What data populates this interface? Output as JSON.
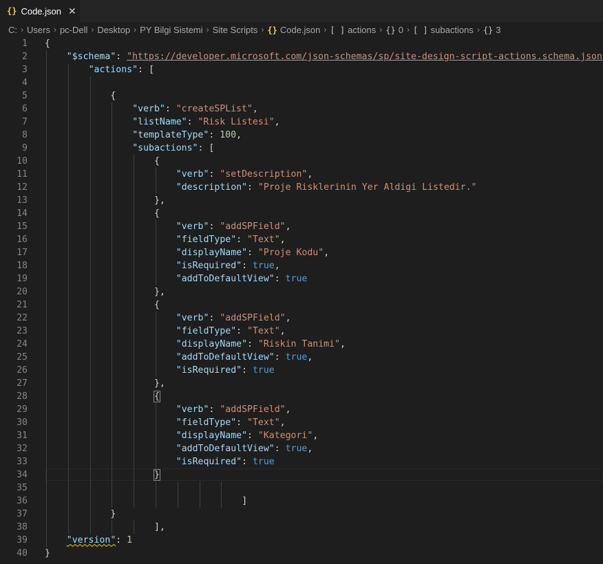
{
  "tab": {
    "icon": "{}",
    "title": "Code.json"
  },
  "breadcrumb": [
    {
      "symbol": "",
      "label": "C:"
    },
    {
      "symbol": "",
      "label": "Users"
    },
    {
      "symbol": "",
      "label": "pc-Dell"
    },
    {
      "symbol": "",
      "label": "Desktop"
    },
    {
      "symbol": "",
      "label": "PY Bilgi Sistemi"
    },
    {
      "symbol": "",
      "label": "Site Scripts"
    },
    {
      "symbol": "{}",
      "label": "Code.json"
    },
    {
      "symbol": "[ ]",
      "label": "actions"
    },
    {
      "symbol": "{}",
      "label": "0"
    },
    {
      "symbol": "[ ]",
      "label": "subactions"
    },
    {
      "symbol": "{}",
      "label": "3"
    }
  ],
  "editor": {
    "current_line": 34,
    "lines": [
      {
        "n": "1",
        "indent": 0,
        "tokens": [
          [
            "p",
            "{"
          ]
        ]
      },
      {
        "n": "2",
        "indent": 1,
        "tokens": [
          [
            "k",
            "\"$schema\""
          ],
          [
            "p",
            ": "
          ],
          [
            "u",
            "\"https://developer.microsoft.com/json-schemas/sp/site-design-script-actions.schema.json\""
          ],
          [
            "p",
            ","
          ]
        ]
      },
      {
        "n": "3",
        "indent": 2,
        "tokens": [
          [
            "k",
            "\"actions\""
          ],
          [
            "p",
            ": ["
          ]
        ]
      },
      {
        "n": "4",
        "indent": 0,
        "tokens": []
      },
      {
        "n": "5",
        "indent": 3,
        "tokens": [
          [
            "p",
            "{"
          ]
        ]
      },
      {
        "n": "6",
        "indent": 4,
        "tokens": [
          [
            "k",
            "\"verb\""
          ],
          [
            "p",
            ": "
          ],
          [
            "s",
            "\"createSPList\""
          ],
          [
            "p",
            ","
          ]
        ]
      },
      {
        "n": "7",
        "indent": 4,
        "tokens": [
          [
            "k",
            "\"listName\""
          ],
          [
            "p",
            ": "
          ],
          [
            "s",
            "\"Risk Listesi\""
          ],
          [
            "p",
            ","
          ]
        ]
      },
      {
        "n": "8",
        "indent": 4,
        "tokens": [
          [
            "k",
            "\"templateType\""
          ],
          [
            "p",
            ": "
          ],
          [
            "n",
            "100"
          ],
          [
            "p",
            ","
          ]
        ]
      },
      {
        "n": "9",
        "indent": 4,
        "tokens": [
          [
            "k",
            "\"subactions\""
          ],
          [
            "p",
            ": ["
          ]
        ]
      },
      {
        "n": "10",
        "indent": 5,
        "tokens": [
          [
            "p",
            "{"
          ]
        ]
      },
      {
        "n": "11",
        "indent": 6,
        "tokens": [
          [
            "k",
            "\"verb\""
          ],
          [
            "p",
            ": "
          ],
          [
            "s",
            "\"setDescription\""
          ],
          [
            "p",
            ","
          ]
        ]
      },
      {
        "n": "12",
        "indent": 6,
        "tokens": [
          [
            "k",
            "\"description\""
          ],
          [
            "p",
            ": "
          ],
          [
            "s",
            "\"Proje Risklerinin Yer Aldigi Listedir.\""
          ]
        ]
      },
      {
        "n": "13",
        "indent": 5,
        "tokens": [
          [
            "p",
            "},"
          ]
        ]
      },
      {
        "n": "14",
        "indent": 5,
        "tokens": [
          [
            "p",
            "{"
          ]
        ]
      },
      {
        "n": "15",
        "indent": 6,
        "tokens": [
          [
            "k",
            "\"verb\""
          ],
          [
            "p",
            ": "
          ],
          [
            "s",
            "\"addSPField\""
          ],
          [
            "p",
            ","
          ]
        ]
      },
      {
        "n": "16",
        "indent": 6,
        "tokens": [
          [
            "k",
            "\"fieldType\""
          ],
          [
            "p",
            ": "
          ],
          [
            "s",
            "\"Text\""
          ],
          [
            "p",
            ","
          ]
        ]
      },
      {
        "n": "17",
        "indent": 6,
        "tokens": [
          [
            "k",
            "\"displayName\""
          ],
          [
            "p",
            ": "
          ],
          [
            "s",
            "\"Proje Kodu\""
          ],
          [
            "p",
            ","
          ]
        ]
      },
      {
        "n": "18",
        "indent": 6,
        "tokens": [
          [
            "k",
            "\"isRequired\""
          ],
          [
            "p",
            ": "
          ],
          [
            "b",
            "true"
          ],
          [
            "p",
            ","
          ]
        ]
      },
      {
        "n": "19",
        "indent": 6,
        "tokens": [
          [
            "k",
            "\"addToDefaultView\""
          ],
          [
            "p",
            ": "
          ],
          [
            "b",
            "true"
          ]
        ]
      },
      {
        "n": "20",
        "indent": 5,
        "tokens": [
          [
            "p",
            "},"
          ]
        ]
      },
      {
        "n": "21",
        "indent": 5,
        "tokens": [
          [
            "p",
            "{"
          ]
        ]
      },
      {
        "n": "22",
        "indent": 6,
        "tokens": [
          [
            "k",
            "\"verb\""
          ],
          [
            "p",
            ": "
          ],
          [
            "s",
            "\"addSPField\""
          ],
          [
            "p",
            ","
          ]
        ]
      },
      {
        "n": "23",
        "indent": 6,
        "tokens": [
          [
            "k",
            "\"fieldType\""
          ],
          [
            "p",
            ": "
          ],
          [
            "s",
            "\"Text\""
          ],
          [
            "p",
            ","
          ]
        ]
      },
      {
        "n": "24",
        "indent": 6,
        "tokens": [
          [
            "k",
            "\"displayName\""
          ],
          [
            "p",
            ": "
          ],
          [
            "s",
            "\"Riskin Tanimi\""
          ],
          [
            "p",
            ","
          ]
        ]
      },
      {
        "n": "25",
        "indent": 6,
        "tokens": [
          [
            "k",
            "\"addToDefaultView\""
          ],
          [
            "p",
            ": "
          ],
          [
            "b",
            "true"
          ],
          [
            "p",
            ","
          ]
        ]
      },
      {
        "n": "26",
        "indent": 6,
        "tokens": [
          [
            "k",
            "\"isRequired\""
          ],
          [
            "p",
            ": "
          ],
          [
            "b",
            "true"
          ]
        ]
      },
      {
        "n": "27",
        "indent": 5,
        "tokens": [
          [
            "p",
            "},"
          ]
        ]
      },
      {
        "n": "28",
        "indent": 5,
        "tokens": [
          [
            "bm",
            "{"
          ]
        ]
      },
      {
        "n": "29",
        "indent": 6,
        "tokens": [
          [
            "k",
            "\"verb\""
          ],
          [
            "p",
            ": "
          ],
          [
            "s",
            "\"addSPField\""
          ],
          [
            "p",
            ","
          ]
        ]
      },
      {
        "n": "30",
        "indent": 6,
        "tokens": [
          [
            "k",
            "\"fieldType\""
          ],
          [
            "p",
            ": "
          ],
          [
            "s",
            "\"Text\""
          ],
          [
            "p",
            ","
          ]
        ]
      },
      {
        "n": "31",
        "indent": 6,
        "tokens": [
          [
            "k",
            "\"displayName\""
          ],
          [
            "p",
            ": "
          ],
          [
            "s",
            "\"Kategori\""
          ],
          [
            "p",
            ","
          ]
        ]
      },
      {
        "n": "32",
        "indent": 6,
        "tokens": [
          [
            "k",
            "\"addToDefaultView\""
          ],
          [
            "p",
            ": "
          ],
          [
            "b",
            "true"
          ],
          [
            "p",
            ","
          ]
        ]
      },
      {
        "n": "33",
        "indent": 6,
        "tokens": [
          [
            "k",
            "\"isRequired\""
          ],
          [
            "p",
            ": "
          ],
          [
            "b",
            "true"
          ]
        ]
      },
      {
        "n": "34",
        "indent": 5,
        "tokens": [
          [
            "bm",
            "}"
          ]
        ]
      },
      {
        "n": "35",
        "indent": 0,
        "tokens": []
      },
      {
        "n": "36",
        "indent": 9,
        "tokens": [
          [
            "p",
            "]"
          ]
        ]
      },
      {
        "n": "37",
        "indent": 3,
        "tokens": [
          [
            "p",
            "}"
          ]
        ]
      },
      {
        "n": "38",
        "indent": 5,
        "tokens": [
          [
            "p",
            "],"
          ]
        ]
      },
      {
        "n": "39",
        "indent": 1,
        "tokens": [
          [
            "w",
            "\"version\""
          ],
          [
            "p",
            ": "
          ],
          [
            "n",
            "1"
          ]
        ]
      },
      {
        "n": "40",
        "indent": 0,
        "tokens": [
          [
            "p",
            "}"
          ]
        ]
      }
    ]
  }
}
